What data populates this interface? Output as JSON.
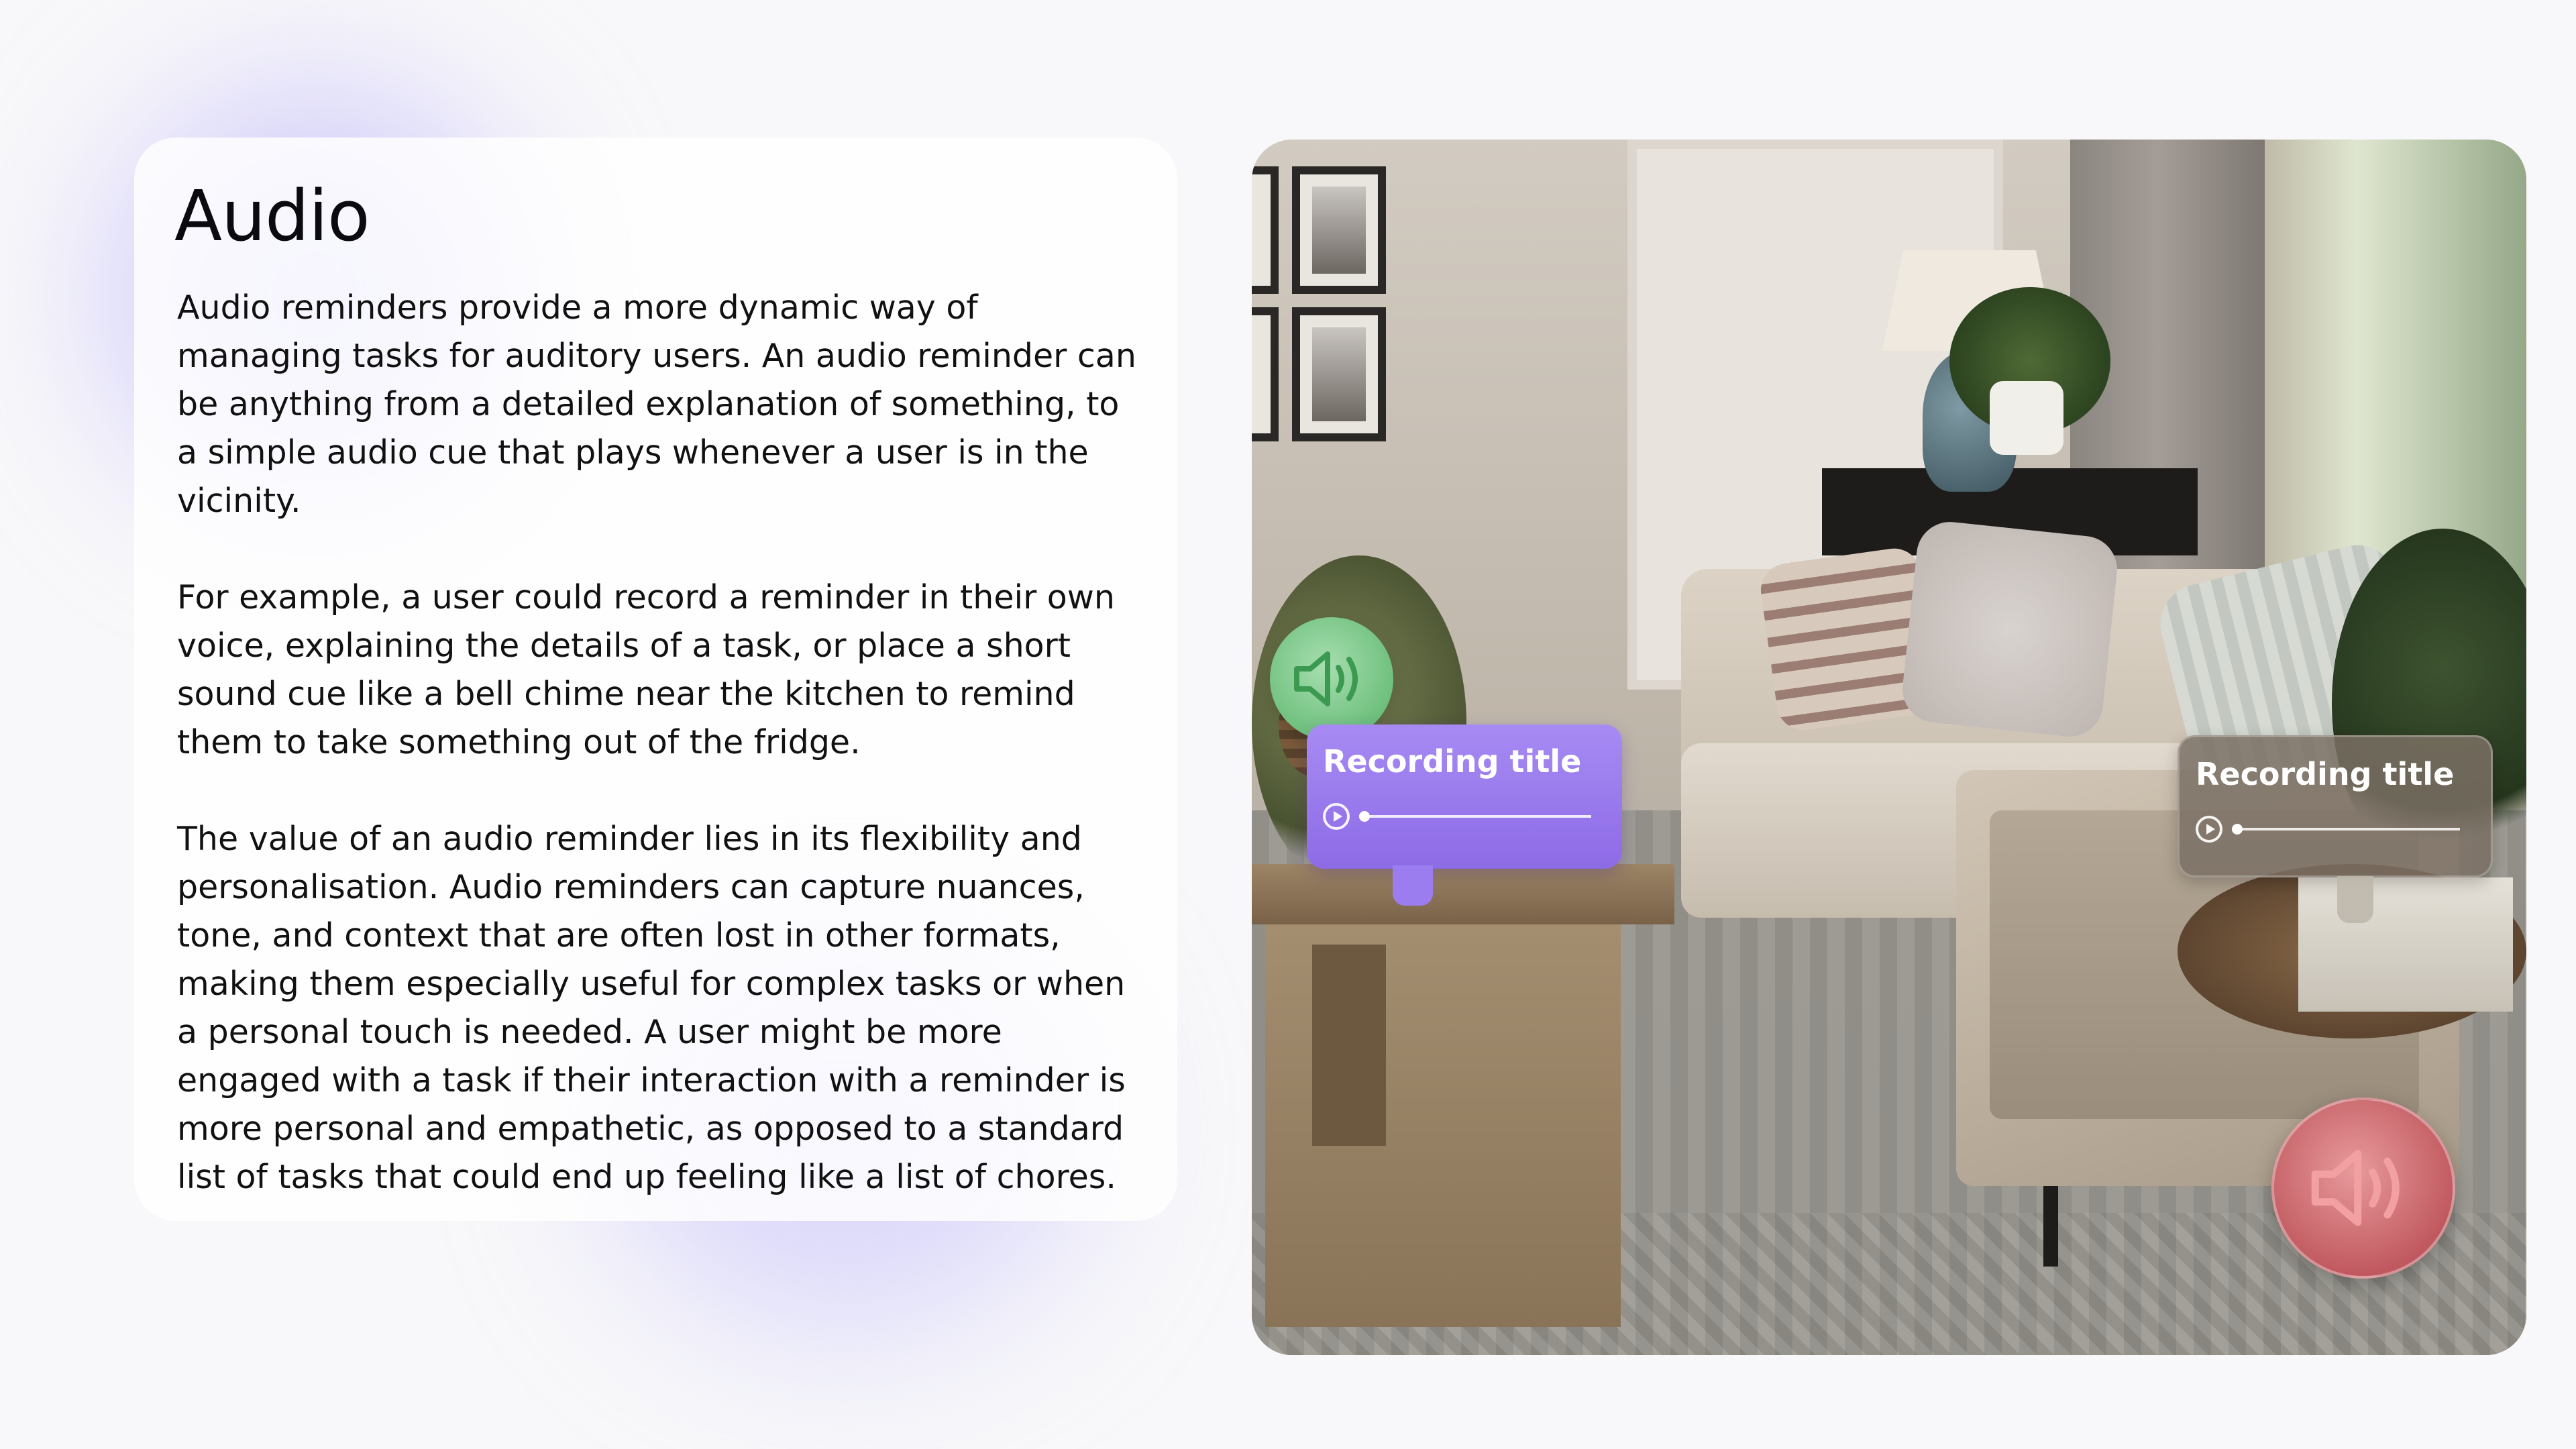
{
  "heading": "Audio",
  "paragraphs": [
    "Audio reminders provide a more dynamic way of managing tasks for auditory users. An audio reminder can be anything from a detailed explanation of something, to a simple audio cue that plays whenever a user is in the vicinity.",
    "For example, a user could record a reminder in their own voice, explaining the details of a task, or place a short sound cue like a bell chime near the kitchen to remind them to take something out of the fridge.",
    "The value of an audio reminder lies in its flexibility and personalisation. Audio reminders can capture nuances, tone, and context that are often lost in other formats, making them especially useful for complex tasks or when a personal touch is needed. A user might be more engaged with a task if their interaction with a reminder is more personal and empathetic, as opposed to a standard list of tasks that could end up feeling like a list of chores."
  ],
  "recordings": [
    {
      "title": "Recording title",
      "progress": 0
    },
    {
      "title": "Recording title",
      "progress": 0
    }
  ],
  "icons": {
    "speaker_green": "speaker-icon",
    "speaker_red": "speaker-icon",
    "play": "play-icon"
  },
  "colors": {
    "background": "#f8f8fa",
    "card": "#ffffff",
    "glow": "#b2aafa",
    "recording_purple": "#9b7df0",
    "recording_gray": "#7a7064",
    "speaker_green": "#7fcf8c",
    "speaker_green_icon": "#3c9a50",
    "speaker_red": "#d06a6f",
    "speaker_red_icon": "#f2a0a2"
  }
}
